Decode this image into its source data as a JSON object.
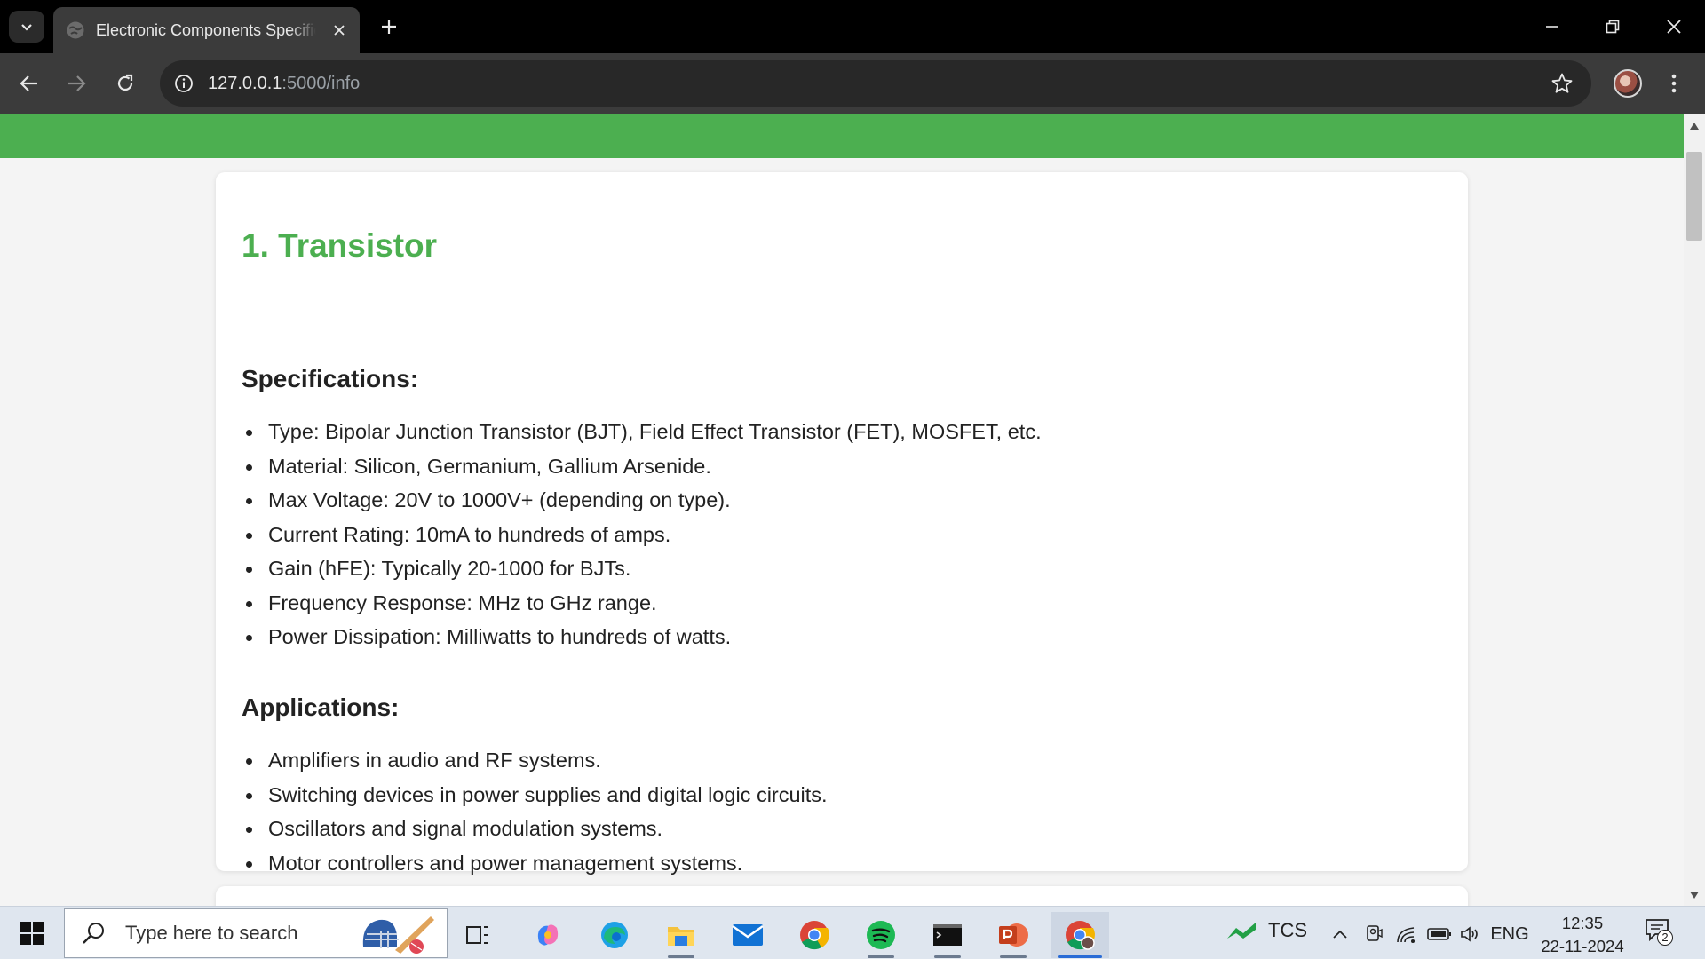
{
  "browser": {
    "tab": {
      "title": "Electronic Components Specifications",
      "favicon": "globe-icon"
    },
    "url": {
      "host": "127.0.0.1",
      "path": ":5000/info"
    }
  },
  "page": {
    "header_color": "#4caf50",
    "component": {
      "title": "1. Transistor",
      "specs_heading": "Specifications:",
      "specs": [
        "Type: Bipolar Junction Transistor (BJT), Field Effect Transistor (FET), MOSFET, etc.",
        "Material: Silicon, Germanium, Gallium Arsenide.",
        "Max Voltage: 20V to 1000V+ (depending on type).",
        "Current Rating: 10mA to hundreds of amps.",
        "Gain (hFE): Typically 20-1000 for BJTs.",
        "Frequency Response: MHz to GHz range.",
        "Power Dissipation: Milliwatts to hundreds of watts."
      ],
      "apps_heading": "Applications:",
      "applications": [
        "Amplifiers in audio and RF systems.",
        "Switching devices in power supplies and digital logic circuits.",
        "Oscillators and signal modulation systems.",
        "Motor controllers and power management systems."
      ]
    }
  },
  "taskbar": {
    "search_placeholder": "Type here to search",
    "apps": [
      "task-view",
      "copilot",
      "edge",
      "file-explorer",
      "mail",
      "chrome",
      "spotify",
      "terminal",
      "powerpoint",
      "chrome-profile"
    ],
    "stock": {
      "ticker": "TCS"
    },
    "language": "ENG",
    "time": "12:35",
    "date": "22-11-2024",
    "notification_count": "2"
  }
}
